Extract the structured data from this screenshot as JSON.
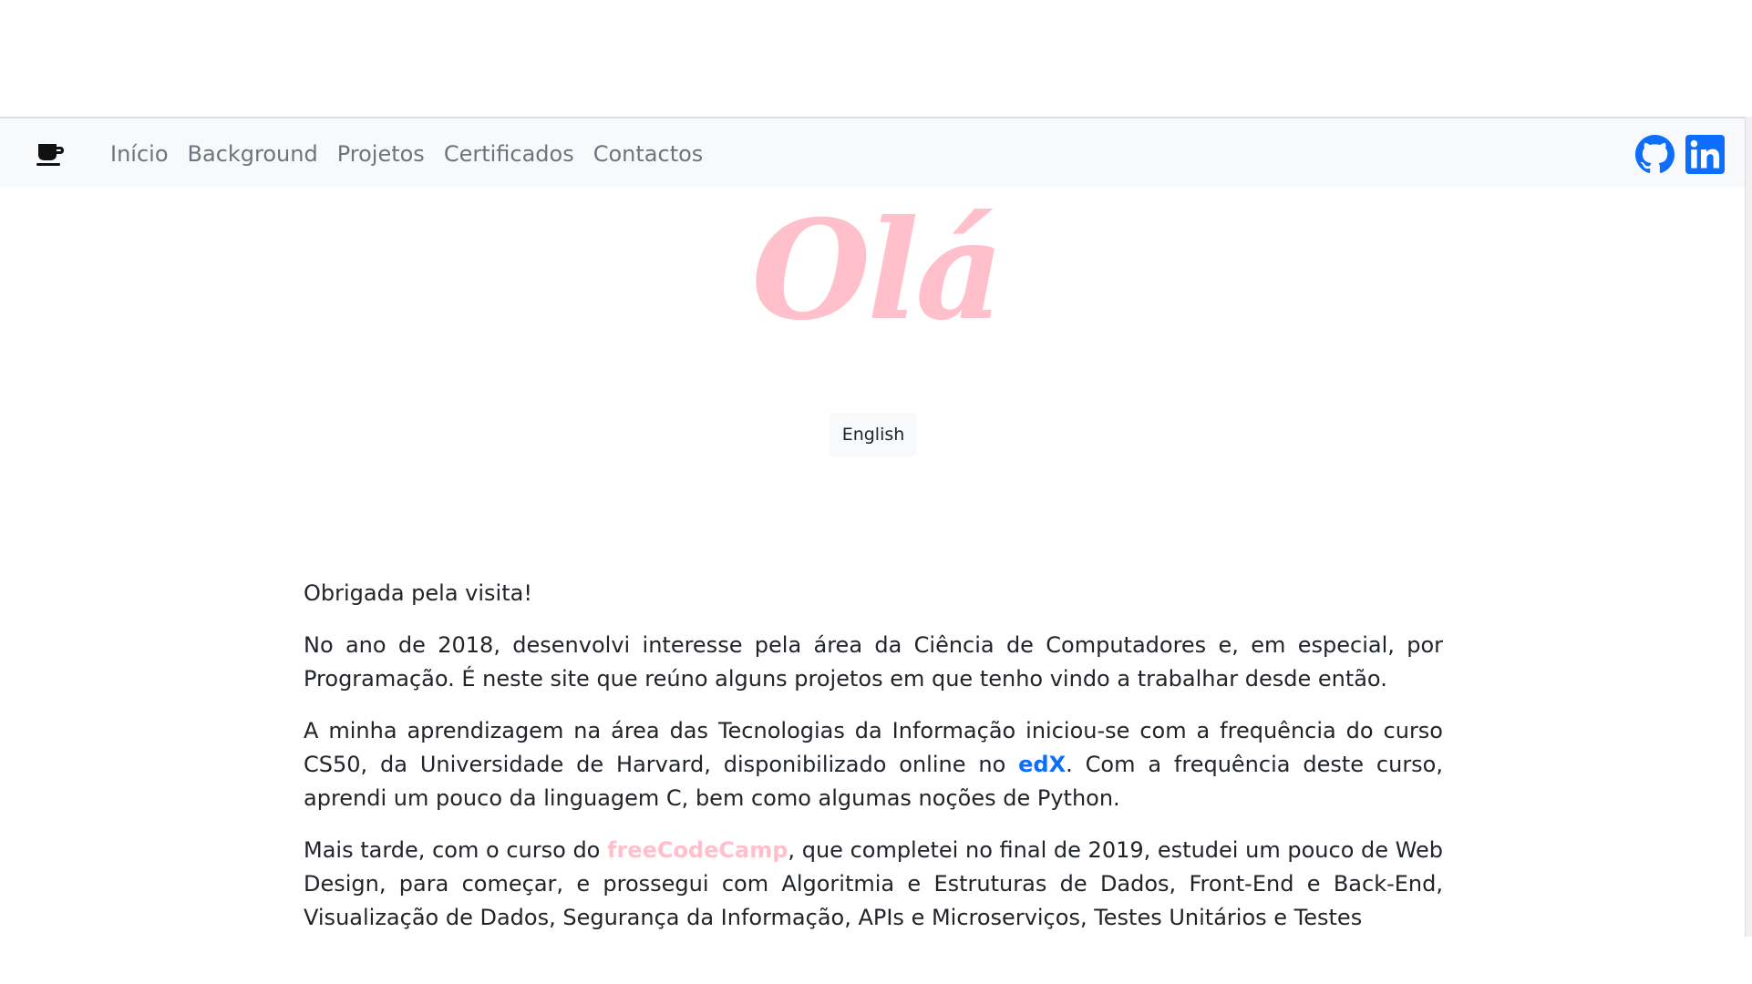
{
  "navbar": {
    "brand_icon": "coffee-cup-icon",
    "links": [
      "Início",
      "Background",
      "Projetos",
      "Certificados",
      "Contactos"
    ],
    "social": [
      {
        "name": "github-icon",
        "color": "#0d6efd"
      },
      {
        "name": "linkedin-icon",
        "color": "#0d6efd"
      }
    ]
  },
  "hero": {
    "title": "Olá",
    "title_color": "#ffc0cb",
    "language_button": "English"
  },
  "content": {
    "greeting": "Obrigada pela visita!",
    "p1": "No ano de 2018, desenvolvi interesse pela área da Ciência de Computadores e, em especial, por Programação. É neste site que reúno alguns projetos em que tenho vindo a trabalhar desde então.",
    "p2_before": "A minha aprendizagem na área das Tecnologias da Informação iniciou-se com a frequência do curso CS50, da Universidade de Harvard, disponibilizado online no ",
    "p2_link": "edX",
    "p2_after": ". Com a frequência deste curso, aprendi um pouco da linguagem C, bem como algumas noções de Python.",
    "p3_before": "Mais tarde, com o curso do ",
    "p3_link": "freeCodeCamp",
    "p3_after": ", que completei no final de 2019, estudei um pouco de Web Design, para começar, e prossegui com Algoritmia e Estruturas de Dados, Front-End e Back-End, Visualização de Dados, Segurança da Informação, APIs e Microserviços, Testes Unitários e Testes"
  },
  "colors": {
    "accent_blue": "#0d6efd",
    "accent_pink": "#ffc0cb",
    "nav_text": "#6c757d",
    "nav_bg": "#f8f9fa"
  }
}
